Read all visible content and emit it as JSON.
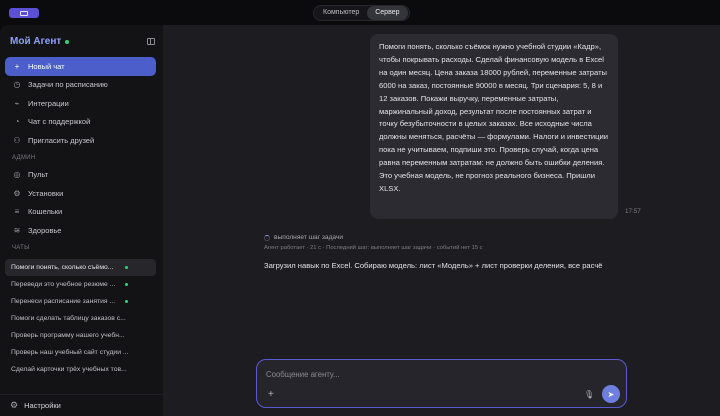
{
  "topbar": {
    "tabs": [
      "Компьютер",
      "Сервер"
    ],
    "active_tab": "Сервер"
  },
  "sidebar": {
    "brand": "Мой Агент",
    "new_chat": "Новый чат",
    "items": [
      {
        "label": "Задачи по расписанию",
        "icon": "clock-icon"
      },
      {
        "label": "Интеграции",
        "icon": "plug-icon"
      },
      {
        "label": "Чат с поддержкой",
        "icon": "support-icon"
      },
      {
        "label": "Пригласить друзей",
        "icon": "invite-icon"
      }
    ],
    "admin_title": "АДМИН",
    "admin_items": [
      {
        "label": "Пульт",
        "icon": "dashboard-icon"
      },
      {
        "label": "Установки",
        "icon": "settings-sliders-icon"
      },
      {
        "label": "Кошельки",
        "icon": "wallet-icon"
      },
      {
        "label": "Здоровье",
        "icon": "health-icon"
      }
    ],
    "chats_title": "ЧАТЫ",
    "chats": [
      {
        "label": "Помоги понять, сколько съёмо...",
        "active": true,
        "dot": true
      },
      {
        "label": "Переведи это учебное резюме ...",
        "active": false,
        "dot": true
      },
      {
        "label": "Перенеси расписание занятия ...",
        "active": false,
        "dot": true
      },
      {
        "label": "Помоги сделать таблицу заказов с...",
        "active": false,
        "dot": false
      },
      {
        "label": "Проверь программу нашего учебн...",
        "active": false,
        "dot": false
      },
      {
        "label": "Проверь наш учебный сайт студии ...",
        "active": false,
        "dot": false
      },
      {
        "label": "Сделай карточки трёх учебных тов...",
        "active": false,
        "dot": false
      }
    ],
    "settings": "Настройки"
  },
  "main": {
    "user_message": "Помоги понять, сколько съёмок нужно учебной студии «Кадр», чтобы покрывать расходы. Сделай финансовую модель в Excel на один месяц. Цена заказа 18000 рублей, переменные затраты 6000 на заказ, постоянные 90000 в месяц. Три сценария: 5, 8 и 12 заказов. Покажи выручку, переменные затраты, маржинальный доход, результат после постоянных затрат и точку безубыточности в целых заказах. Все исходные числа должны меняться, расчёты — формулами. Налоги и инвестиции пока не учитываем, подпиши это. Проверь случай, когда цена равна переменным затратам: не должно быть ошибки деления. Это учебная модель, не прогноз реального бизнеса. Пришли XLSX.",
    "user_message_time": "17:57",
    "status": "выполняет шаг задачи",
    "status_sub": "Агент работает · 21 с · Последний шаг: выполняет шаг задачи · событий нет 15 с",
    "agent_reply": "Загрузил навык по Excel. Собираю модель: лист «Модель» + лист проверки деления, все расчё",
    "composer_placeholder": "Сообщение агенту..."
  },
  "colors": {
    "accent": "#4c5ec9",
    "brand": "#8ea0ff",
    "online": "#34d37a",
    "composer_border": "#5a5bd0"
  }
}
